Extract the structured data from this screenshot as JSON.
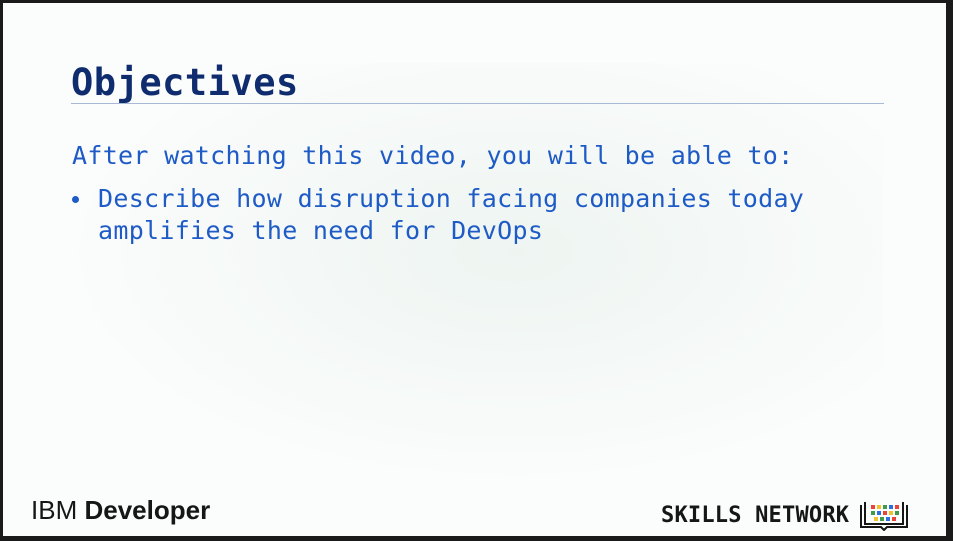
{
  "slide": {
    "title": "Objectives",
    "intro": "After watching this video, you will be able to:",
    "bullets": [
      "Describe how disruption facing companies today amplifies the need for DevOps"
    ]
  },
  "footer": {
    "left_logo": {
      "ibm": "IBM",
      "developer": "Developer"
    },
    "right_logo": {
      "text": "SKILLS NETWORK",
      "icon": "book-pixels-icon"
    }
  },
  "colors": {
    "title": "#0f2d6e",
    "body": "#1e5bc6",
    "rule": "#a9b8d4",
    "background": "#fbfcfc"
  }
}
